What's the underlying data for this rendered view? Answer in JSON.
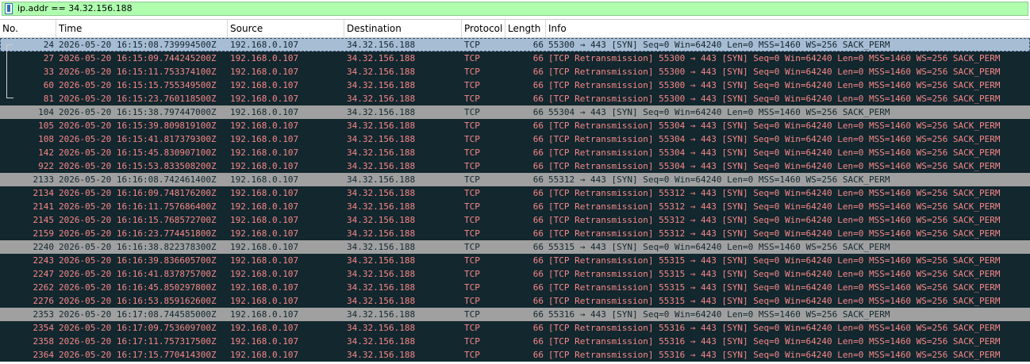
{
  "filter": {
    "value": "ip.addr == 34.32.156.188"
  },
  "columns": [
    "No.",
    "Time",
    "Source",
    "Destination",
    "Protocol",
    "Length",
    "Info"
  ],
  "packets": [
    {
      "no": "24",
      "time": "2026-05-20 16:15:08.739994500Z",
      "src": "192.168.0.107",
      "dst": "34.32.156.188",
      "proto": "TCP",
      "len": "66",
      "info": "55300 → 443 [SYN] Seq=0 Win=64240 Len=0 MSS=1460 WS=256 SACK_PERM",
      "kind": "selected"
    },
    {
      "no": "27",
      "time": "2026-05-20 16:15:09.744245200Z",
      "src": "192.168.0.107",
      "dst": "34.32.156.188",
      "proto": "TCP",
      "len": "66",
      "info": "[TCP Retransmission] 55300 → 443 [SYN] Seq=0 Win=64240 Len=0 MSS=1460 WS=256 SACK_PERM",
      "kind": "retrans"
    },
    {
      "no": "33",
      "time": "2026-05-20 16:15:11.753374100Z",
      "src": "192.168.0.107",
      "dst": "34.32.156.188",
      "proto": "TCP",
      "len": "66",
      "info": "[TCP Retransmission] 55300 → 443 [SYN] Seq=0 Win=64240 Len=0 MSS=1460 WS=256 SACK_PERM",
      "kind": "retrans"
    },
    {
      "no": "60",
      "time": "2026-05-20 16:15:15.755349500Z",
      "src": "192.168.0.107",
      "dst": "34.32.156.188",
      "proto": "TCP",
      "len": "66",
      "info": "[TCP Retransmission] 55300 → 443 [SYN] Seq=0 Win=64240 Len=0 MSS=1460 WS=256 SACK_PERM",
      "kind": "retrans"
    },
    {
      "no": "81",
      "time": "2026-05-20 16:15:23.760118500Z",
      "src": "192.168.0.107",
      "dst": "34.32.156.188",
      "proto": "TCP",
      "len": "66",
      "info": "[TCP Retransmission] 55300 → 443 [SYN] Seq=0 Win=64240 Len=0 MSS=1460 WS=256 SACK_PERM",
      "kind": "retrans"
    },
    {
      "no": "104",
      "time": "2026-05-20 16:15:38.797447000Z",
      "src": "192.168.0.107",
      "dst": "34.32.156.188",
      "proto": "TCP",
      "len": "66",
      "info": "55304 → 443 [SYN] Seq=0 Win=64240 Len=0 MSS=1460 WS=256 SACK_PERM",
      "kind": "normal"
    },
    {
      "no": "105",
      "time": "2026-05-20 16:15:39.809819100Z",
      "src": "192.168.0.107",
      "dst": "34.32.156.188",
      "proto": "TCP",
      "len": "66",
      "info": "[TCP Retransmission] 55304 → 443 [SYN] Seq=0 Win=64240 Len=0 MSS=1460 WS=256 SACK_PERM",
      "kind": "retrans"
    },
    {
      "no": "108",
      "time": "2026-05-20 16:15:41.817379300Z",
      "src": "192.168.0.107",
      "dst": "34.32.156.188",
      "proto": "TCP",
      "len": "66",
      "info": "[TCP Retransmission] 55304 → 443 [SYN] Seq=0 Win=64240 Len=0 MSS=1460 WS=256 SACK_PERM",
      "kind": "retrans"
    },
    {
      "no": "142",
      "time": "2026-05-20 16:15:45.830907100Z",
      "src": "192.168.0.107",
      "dst": "34.32.156.188",
      "proto": "TCP",
      "len": "66",
      "info": "[TCP Retransmission] 55304 → 443 [SYN] Seq=0 Win=64240 Len=0 MSS=1460 WS=256 SACK_PERM",
      "kind": "retrans"
    },
    {
      "no": "922",
      "time": "2026-05-20 16:15:53.833508200Z",
      "src": "192.168.0.107",
      "dst": "34.32.156.188",
      "proto": "TCP",
      "len": "66",
      "info": "[TCP Retransmission] 55304 → 443 [SYN] Seq=0 Win=64240 Len=0 MSS=1460 WS=256 SACK_PERM",
      "kind": "retrans"
    },
    {
      "no": "2133",
      "time": "2026-05-20 16:16:08.742461400Z",
      "src": "192.168.0.107",
      "dst": "34.32.156.188",
      "proto": "TCP",
      "len": "66",
      "info": "55312 → 443 [SYN] Seq=0 Win=64240 Len=0 MSS=1460 WS=256 SACK_PERM",
      "kind": "normal"
    },
    {
      "no": "2134",
      "time": "2026-05-20 16:16:09.748176200Z",
      "src": "192.168.0.107",
      "dst": "34.32.156.188",
      "proto": "TCP",
      "len": "66",
      "info": "[TCP Retransmission] 55312 → 443 [SYN] Seq=0 Win=64240 Len=0 MSS=1460 WS=256 SACK_PERM",
      "kind": "retrans"
    },
    {
      "no": "2141",
      "time": "2026-05-20 16:16:11.757686400Z",
      "src": "192.168.0.107",
      "dst": "34.32.156.188",
      "proto": "TCP",
      "len": "66",
      "info": "[TCP Retransmission] 55312 → 443 [SYN] Seq=0 Win=64240 Len=0 MSS=1460 WS=256 SACK_PERM",
      "kind": "retrans"
    },
    {
      "no": "2145",
      "time": "2026-05-20 16:16:15.768572700Z",
      "src": "192.168.0.107",
      "dst": "34.32.156.188",
      "proto": "TCP",
      "len": "66",
      "info": "[TCP Retransmission] 55312 → 443 [SYN] Seq=0 Win=64240 Len=0 MSS=1460 WS=256 SACK_PERM",
      "kind": "retrans"
    },
    {
      "no": "2159",
      "time": "2026-05-20 16:16:23.774451800Z",
      "src": "192.168.0.107",
      "dst": "34.32.156.188",
      "proto": "TCP",
      "len": "66",
      "info": "[TCP Retransmission] 55312 → 443 [SYN] Seq=0 Win=64240 Len=0 MSS=1460 WS=256 SACK_PERM",
      "kind": "retrans"
    },
    {
      "no": "2240",
      "time": "2026-05-20 16:16:38.822378300Z",
      "src": "192.168.0.107",
      "dst": "34.32.156.188",
      "proto": "TCP",
      "len": "66",
      "info": "55315 → 443 [SYN] Seq=0 Win=64240 Len=0 MSS=1460 WS=256 SACK_PERM",
      "kind": "normal"
    },
    {
      "no": "2243",
      "time": "2026-05-20 16:16:39.836605700Z",
      "src": "192.168.0.107",
      "dst": "34.32.156.188",
      "proto": "TCP",
      "len": "66",
      "info": "[TCP Retransmission] 55315 → 443 [SYN] Seq=0 Win=64240 Len=0 MSS=1460 WS=256 SACK_PERM",
      "kind": "retrans"
    },
    {
      "no": "2247",
      "time": "2026-05-20 16:16:41.837875700Z",
      "src": "192.168.0.107",
      "dst": "34.32.156.188",
      "proto": "TCP",
      "len": "66",
      "info": "[TCP Retransmission] 55315 → 443 [SYN] Seq=0 Win=64240 Len=0 MSS=1460 WS=256 SACK_PERM",
      "kind": "retrans"
    },
    {
      "no": "2262",
      "time": "2026-05-20 16:16:45.850297800Z",
      "src": "192.168.0.107",
      "dst": "34.32.156.188",
      "proto": "TCP",
      "len": "66",
      "info": "[TCP Retransmission] 55315 → 443 [SYN] Seq=0 Win=64240 Len=0 MSS=1460 WS=256 SACK_PERM",
      "kind": "retrans"
    },
    {
      "no": "2276",
      "time": "2026-05-20 16:16:53.859162600Z",
      "src": "192.168.0.107",
      "dst": "34.32.156.188",
      "proto": "TCP",
      "len": "66",
      "info": "[TCP Retransmission] 55315 → 443 [SYN] Seq=0 Win=64240 Len=0 MSS=1460 WS=256 SACK_PERM",
      "kind": "retrans"
    },
    {
      "no": "2353",
      "time": "2026-05-20 16:17:08.744585000Z",
      "src": "192.168.0.107",
      "dst": "34.32.156.188",
      "proto": "TCP",
      "len": "66",
      "info": "55316 → 443 [SYN] Seq=0 Win=64240 Len=0 MSS=1460 WS=256 SACK_PERM",
      "kind": "normal"
    },
    {
      "no": "2354",
      "time": "2026-05-20 16:17:09.753609700Z",
      "src": "192.168.0.107",
      "dst": "34.32.156.188",
      "proto": "TCP",
      "len": "66",
      "info": "[TCP Retransmission] 55316 → 443 [SYN] Seq=0 Win=64240 Len=0 MSS=1460 WS=256 SACK_PERM",
      "kind": "retrans"
    },
    {
      "no": "2358",
      "time": "2026-05-20 16:17:11.757317500Z",
      "src": "192.168.0.107",
      "dst": "34.32.156.188",
      "proto": "TCP",
      "len": "66",
      "info": "[TCP Retransmission] 55316 → 443 [SYN] Seq=0 Win=64240 Len=0 MSS=1460 WS=256 SACK_PERM",
      "kind": "retrans"
    },
    {
      "no": "2364",
      "time": "2026-05-20 16:17:15.770414300Z",
      "src": "192.168.0.107",
      "dst": "34.32.156.188",
      "proto": "TCP",
      "len": "66",
      "info": "[TCP Retransmission] 55316 → 443 [SYN] Seq=0 Win=64240 Len=0 MSS=1460 WS=256 SACK_PERM",
      "kind": "retrans"
    }
  ]
}
